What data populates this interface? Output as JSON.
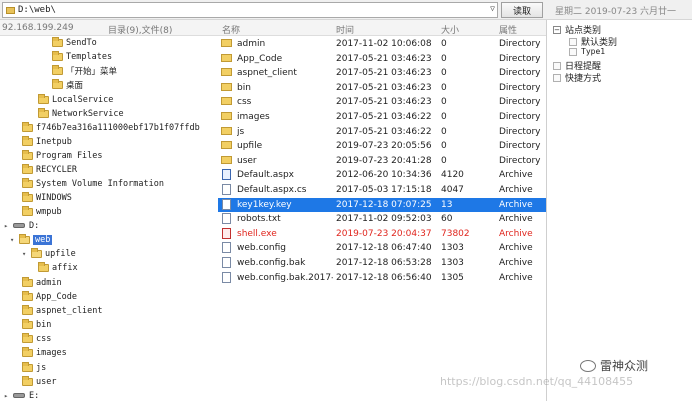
{
  "topbar": {
    "path": "D:\\web\\",
    "dropdown_glyph": "▽",
    "read_button": "读取",
    "date_text": "星期二 2019-07-23 六月廿一"
  },
  "tree_header": {
    "ip": "92.168.199.249",
    "count": "目录(9),文件(8)"
  },
  "list_header": {
    "name": "名称",
    "time": "时间",
    "size": "大小",
    "attr": "属性"
  },
  "tree": [
    {
      "label": "SendTo",
      "indent": 4
    },
    {
      "label": "Templates",
      "indent": 4
    },
    {
      "label": "「开始」菜单",
      "indent": 4
    },
    {
      "label": "桌面",
      "indent": 4
    },
    {
      "label": "LocalService",
      "indent": 3
    },
    {
      "label": "NetworkService",
      "indent": 3
    },
    {
      "label": "f746b7ea316a111000ebf17b1f07ffdb",
      "indent": 2
    },
    {
      "label": "Inetpub",
      "indent": 2
    },
    {
      "label": "Program Files",
      "indent": 2
    },
    {
      "label": "RECYCLER",
      "indent": 2
    },
    {
      "label": "System Volume Information",
      "indent": 2
    },
    {
      "label": "WINDOWS",
      "indent": 2
    },
    {
      "label": "wmpub",
      "indent": 2
    },
    {
      "label": "D:",
      "indent": 0,
      "drive": true
    },
    {
      "label": "web",
      "indent": 1,
      "selected": true,
      "open": true
    },
    {
      "label": "upfile",
      "indent": 2,
      "open": true
    },
    {
      "label": "affix",
      "indent": 3
    },
    {
      "label": "admin",
      "indent": 2
    },
    {
      "label": "App_Code",
      "indent": 2
    },
    {
      "label": "aspnet_client",
      "indent": 2
    },
    {
      "label": "bin",
      "indent": 2
    },
    {
      "label": "css",
      "indent": 2
    },
    {
      "label": "images",
      "indent": 2
    },
    {
      "label": "js",
      "indent": 2
    },
    {
      "label": "user",
      "indent": 2
    },
    {
      "label": "E:",
      "indent": 0,
      "drive": true
    }
  ],
  "files": [
    {
      "name": "admin",
      "time": "2017-11-02 10:06:08",
      "size": "0",
      "attr": "Directory",
      "type": "folder"
    },
    {
      "name": "App_Code",
      "time": "2017-05-21 03:46:23",
      "size": "0",
      "attr": "Directory",
      "type": "folder"
    },
    {
      "name": "aspnet_client",
      "time": "2017-05-21 03:46:23",
      "size": "0",
      "attr": "Directory",
      "type": "folder"
    },
    {
      "name": "bin",
      "time": "2017-05-21 03:46:23",
      "size": "0",
      "attr": "Directory",
      "type": "folder"
    },
    {
      "name": "css",
      "time": "2017-05-21 03:46:23",
      "size": "0",
      "attr": "Directory",
      "type": "folder"
    },
    {
      "name": "images",
      "time": "2017-05-21 03:46:22",
      "size": "0",
      "attr": "Directory",
      "type": "folder"
    },
    {
      "name": "js",
      "time": "2017-05-21 03:46:22",
      "size": "0",
      "attr": "Directory",
      "type": "folder"
    },
    {
      "name": "upfile",
      "time": "2019-07-23 20:05:56",
      "size": "0",
      "attr": "Directory",
      "type": "folder"
    },
    {
      "name": "user",
      "time": "2019-07-23 20:41:28",
      "size": "0",
      "attr": "Directory",
      "type": "folder"
    },
    {
      "name": "Default.aspx",
      "time": "2012-06-20 10:34:36",
      "size": "4120",
      "attr": "Archive",
      "type": "aspx"
    },
    {
      "name": "Default.aspx.cs",
      "time": "2017-05-03 17:15:18",
      "size": "4047",
      "attr": "Archive",
      "type": "file"
    },
    {
      "name": "key1key.key",
      "time": "2017-12-18 07:07:25",
      "size": "13",
      "attr": "Archive",
      "type": "file",
      "selected": true
    },
    {
      "name": "robots.txt",
      "time": "2017-11-02 09:52:03",
      "size": "60",
      "attr": "Archive",
      "type": "file"
    },
    {
      "name": "shell.exe",
      "time": "2019-07-23 20:04:37",
      "size": "73802",
      "attr": "Archive",
      "type": "exe",
      "red": true
    },
    {
      "name": "web.config",
      "time": "2017-12-18 06:47:40",
      "size": "1303",
      "attr": "Archive",
      "type": "file"
    },
    {
      "name": "web.config.bak",
      "time": "2017-12-18 06:53:28",
      "size": "1303",
      "attr": "Archive",
      "type": "file"
    },
    {
      "name": "web.config.bak.2017-1...",
      "time": "2017-12-18 06:56:40",
      "size": "1305",
      "attr": "Archive",
      "type": "file"
    }
  ],
  "right_pane": {
    "site_category": "站点类别",
    "default_category": "默认类别",
    "type1": "Type1",
    "schedule_reminder": "日程提醒",
    "shortcuts": "快捷方式",
    "expand_glyph": "−"
  },
  "watermark": "https://blog.csdn.net/qq_44108455",
  "brand": "雷神众测",
  "colors": {
    "selection": "#1e78e6",
    "tree_selection": "#3b74d6",
    "danger": "#e0261e",
    "folder": "#f2cf63"
  }
}
